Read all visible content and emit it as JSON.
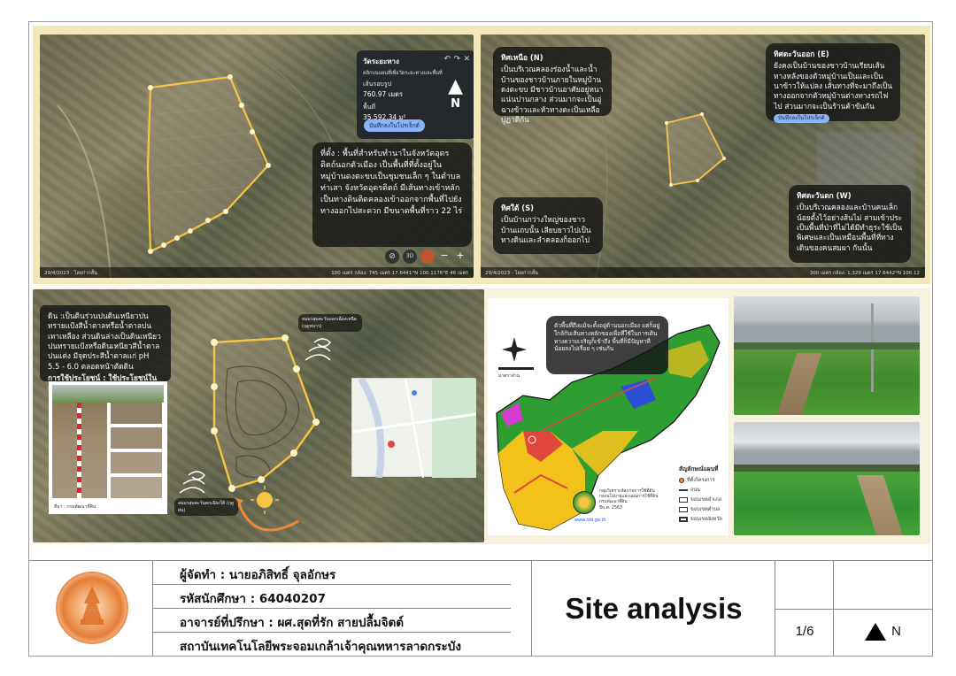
{
  "panel_a": {
    "location_text": "ที่ตั้ง : พื้นที่สำหรับทำนาในจังหวัดอุดรดิตถ์นอกตัวเมือง เป็นพื้นที่ที่ตั้งอยู่ในหมู่บ้านดงตะขบเป็นชุมชนเล็ก ๆ ในตำบลท่าเสา จังหวัดอุดรดิตถ์ มีเส้นทางเข้าหลักเป็นทางดินติดคลองเข้าออกจากพื้นที่ไปยังทางออกไปสะดวก มีขนาดพื้นที่ราว 22 ไร่",
    "measure": {
      "title": "วัดระยะทาง",
      "hint": "คลิกบนแผนที่เพื่อวัดระยะทางและพื้นที่",
      "perimeter_label": "เส้นรอบรูป",
      "perimeter_value": "760.97 เมตร",
      "area_label": "พื้นที่",
      "area_value": "35,592.34 ม²",
      "save_button": "บันทึกลงในโปรเจ็กต์"
    },
    "north": "N",
    "footer_left": "29/4/2023 · โลยก่ากลั้น",
    "footer_right": "100 เมตร   กล้อง: 745 เมตร   17.6441°N 100.1176°E   46 เมตร"
  },
  "panel_b": {
    "north": {
      "head": "ทิศเหนือ (N)",
      "text": "เป็นบริเวณคลองร่องน้ำและน้ำบ้านของชาวบ้านภายในหมู่บ้านดงตะขบ มีชาวบ้านอาศัยอยู่หนาแน่นปานกลาง ส่วนมากจะเป็นอู่ฉางข้าวและหัวทางตะเป็นเหลือบู่ฏาติกัน"
    },
    "east": {
      "head": "ทิศตะวันออก (E)",
      "text": "ยังคงเป็นบ้านของชาวบ้านเรียบเส้นทางหลังของตัวหมู่บ้านเป็นและเป็นนาข้าวให้แปลง เส้นทางที่จะมาถึงเป็นทางออกจากตัวหมู่บ้านต่างทางรถไฟไป ส่วนมากจะเป็นร้านค้าขันกัน"
    },
    "south": {
      "head": "ทิศใต้ (S)",
      "text": "เป็นบ้านกว่างใหญ่ของชาวบ้านแถบนั้น เลียบยาวไปเป็นทางดินและลำคลองก็ออกไป"
    },
    "west": {
      "head": "ทิศตะวันตก (W)",
      "text": "เป็นบริเวณคลองและบ้านคนเล็กน้อยตั้งไว้อย่างส้นไม่ สามเข้าประเป็นพื้นที่ป่าที่ไม่ได้มีทำธุระใช้เป็นพิเศษและเป็นเหมือนพื้นที่ที่ทางเดินของคนสมผา กันนั้น"
    },
    "save_button": "บันทึกลงในโปรเจ็กต์",
    "footer_left": "29/4/2023 · โลยก่ากลั้น",
    "footer_right": "300 เมตร   กล้อง: 1,329 เมตร   17.6442°N 100.12"
  },
  "panel_c": {
    "soil_text": "ดิน :เป็นดินร่วนปนดินเหนียวปนทรายแป้งสีน้ำตาลหรือน้ำตาลปนเทาเหลือง ส่วนดินล่างเป็นดินเหนียวปนทรายแป้งหรือดินเหนียวสีน้ำตาลปนแต่ง มีจุดประสีน้ำตาลแก่ pH 5.5 - 6.0 ตลอดหน้าตัดดิน",
    "use_text": "การใช้ประโยชน์ : ใช้ประโยชน์ในการปลูกข้าว",
    "soil_caption": "ที่มา : กรมพัฒนาที่ดิน",
    "wind_north_label": "ลมมรสุมตะวันออกเฉียงเหนือ (ฤดูหนาว)",
    "wind_south_label": "ลมมรสุมตะวันตกเฉียงใต้ (ฤดูฝน)"
  },
  "panel_d": {
    "note_text": "ตัวพื้นที่ถึงแม้จะตั้งอยู่ด้านนอกเมือง แต่ก็อยู่ใกล้กับเส้นทางหลักของเพื่อที่ใช้ในการเดินทางความเจริญก็เข้าถึง พื้นที่ก็มีปัญหาที่น้อยลงไปเรื่อย ๆ เช่นกัน",
    "scale_label": "มาตราส่วน",
    "legend_title": "สัญลักษณ์แผนที่",
    "legend": [
      "ที่ตั้งโครงการ",
      "ถนน",
      "ขอบเขตอำเภอ",
      "ขอบเขตตำบล",
      "ขอบเขตจังหวัด"
    ],
    "source_lines": [
      "กลุ่มวิเคราะห์สภาพการใช้ที่ดิน",
      "กองนโยบายและแผนการใช้ที่ดิน",
      "กรมพัฒนาที่ดิน",
      "ปีพ.ศ. 2563"
    ],
    "url": "www.ldd.go.th"
  },
  "title_block": {
    "author": "ผู้จัดทำ : นายอภิสิทธิ์ จุลอักษร",
    "student_id": "รหัสนักศึกษา : 64040207",
    "advisor": "อาจารย์ที่ปรึกษา : ผศ.สุดที่รัก สายปลื้มจิตต์",
    "institute": "สถาบันเทคโนโลยีพระจอมเกล้าเจ้าคุณทหารลาดกระบัง",
    "title": "Site analysis",
    "page": "1/6",
    "north_label": "N"
  },
  "colors": {
    "frame_yellow": "#f3e9b8",
    "boundary_yellow": "#f6c342",
    "landuse_green": "#2f9e32",
    "landuse_yellow": "#f2c21b",
    "landuse_red": "#e0483b",
    "landuse_blue": "#2c4fd8",
    "landuse_magenta": "#d63ccf"
  }
}
